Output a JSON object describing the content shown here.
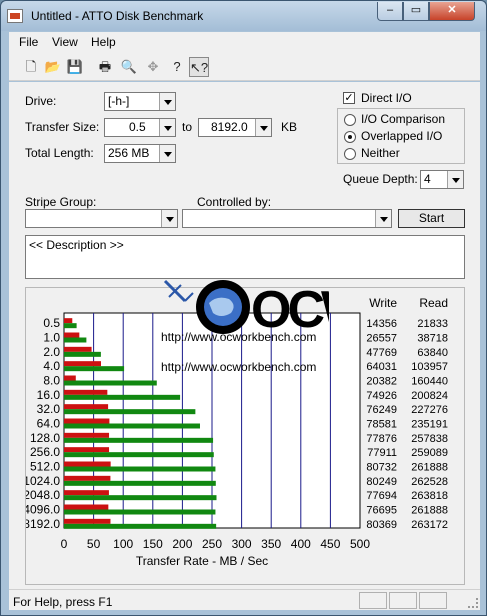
{
  "window": {
    "title": "Untitled - ATTO Disk Benchmark",
    "controls": {
      "min": "–",
      "max": "▭",
      "close": "✕"
    }
  },
  "menu": [
    "File",
    "View",
    "Help"
  ],
  "toolbar": {
    "icons": [
      "new-file-icon",
      "open-folder-icon",
      "save-icon",
      "print-icon",
      "print-preview-icon",
      "move-icon",
      "help-icon",
      "context-help-icon"
    ]
  },
  "form": {
    "drive_label": "Drive:",
    "drive_value": "[-h-]",
    "transfer_size_label": "Transfer Size:",
    "transfer_from": "0.5",
    "to_label": "to",
    "transfer_to": "8192.0",
    "unit_kb": "KB",
    "total_length_label": "Total Length:",
    "total_length_value": "256 MB",
    "direct_io_label": "Direct I/O",
    "direct_io_checked": "✓",
    "io_comparison_label": "I/O Comparison",
    "overlapped_io_label": "Overlapped I/O",
    "neither_label": "Neither",
    "queue_depth_label": "Queue Depth:",
    "queue_depth_value": "4",
    "stripe_group_label": "Stripe Group:",
    "stripe_group_value": "",
    "controlled_by_label": "Controlled by:",
    "controlled_by_value": "",
    "start_label": "Start",
    "description_text": "<< Description >>"
  },
  "results": {
    "write_header": "Write",
    "read_header": "Read",
    "rows": [
      {
        "size": "0.5",
        "write": "14356",
        "read": "21833"
      },
      {
        "size": "1.0",
        "write": "26557",
        "read": "38718"
      },
      {
        "size": "2.0",
        "write": "47769",
        "read": "63840"
      },
      {
        "size": "4.0",
        "write": "64031",
        "read": "103957"
      },
      {
        "size": "8.0",
        "write": "20382",
        "read": "160440"
      },
      {
        "size": "16.0",
        "write": "74926",
        "read": "200824"
      },
      {
        "size": "32.0",
        "write": "76249",
        "read": "227276"
      },
      {
        "size": "64.0",
        "write": "78581",
        "read": "235191"
      },
      {
        "size": "128.0",
        "write": "77876",
        "read": "257838"
      },
      {
        "size": "256.0",
        "write": "77911",
        "read": "259089"
      },
      {
        "size": "512.0",
        "write": "80732",
        "read": "261888"
      },
      {
        "size": "1024.0",
        "write": "80249",
        "read": "262528"
      },
      {
        "size": "2048.0",
        "write": "77694",
        "read": "263818"
      },
      {
        "size": "4096.0",
        "write": "76695",
        "read": "261888"
      },
      {
        "size": "8192.0",
        "write": "80369",
        "read": "263172"
      }
    ]
  },
  "chart_data": {
    "type": "bar",
    "orientation": "horizontal",
    "categories": [
      "0.5",
      "1.0",
      "2.0",
      "4.0",
      "8.0",
      "16.0",
      "32.0",
      "64.0",
      "128.0",
      "256.0",
      "512.0",
      "1024.0",
      "2048.0",
      "4096.0",
      "8192.0"
    ],
    "series": [
      {
        "name": "Write",
        "color": "#cc1111",
        "values": [
          14.0,
          25.9,
          46.6,
          62.5,
          19.9,
          73.2,
          74.5,
          76.7,
          76.1,
          76.1,
          78.8,
          78.4,
          75.9,
          74.9,
          78.5
        ]
      },
      {
        "name": "Read",
        "color": "#118811",
        "values": [
          21.3,
          37.8,
          62.3,
          101.5,
          156.7,
          196.1,
          221.9,
          229.7,
          251.8,
          253.0,
          255.8,
          256.4,
          257.6,
          255.8,
          257.0
        ]
      }
    ],
    "xlabel": "Transfer Rate - MB / Sec",
    "xlim": [
      0,
      500
    ],
    "xticks": [
      0,
      50,
      100,
      150,
      200,
      250,
      300,
      350,
      400,
      450,
      500
    ],
    "grid": true
  },
  "watermark": {
    "logo_text": "OCW",
    "url1": "http://www.ocworkbench.com",
    "url2": "http://www.ocworkbench.com"
  },
  "status": {
    "text": "For Help, press F1"
  }
}
